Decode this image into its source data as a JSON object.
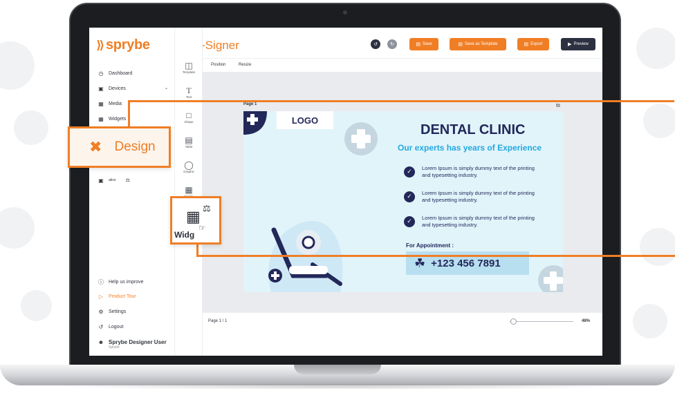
{
  "brand": {
    "logo_text": "sprybe",
    "app_title": "Di-Signer"
  },
  "sidebar": {
    "items": [
      {
        "label": "Dashboard",
        "icon": "dashboard-icon"
      },
      {
        "label": "Devices",
        "icon": "devices-icon"
      },
      {
        "label": "Media",
        "icon": "media-icon"
      },
      {
        "label": "Widgets",
        "icon": "widgets-icon"
      },
      {
        "label": "Help us improve",
        "icon": "help-icon"
      },
      {
        "label": "Product Tour",
        "icon": "tour-icon"
      },
      {
        "label": "Settings",
        "icon": "gear-icon"
      },
      {
        "label": "Logout",
        "icon": "logout-icon"
      }
    ],
    "partial_item": "ativo",
    "user_name": "Sprybe Designer User",
    "user_org": "Sprybe"
  },
  "rail": {
    "tools": [
      "Template",
      "Text",
      "Shape",
      "Table",
      "Graphic",
      "Media"
    ]
  },
  "toolbar": {
    "save": "Save",
    "save_template": "Save as Template",
    "export": "Export",
    "preview": "Preview"
  },
  "subbar": {
    "position": "Position",
    "resize": "Resize"
  },
  "canvas": {
    "page_label": "Page 1",
    "page_count": "Page 1 / 1",
    "zoom": "48%",
    "zoom_fraction": 0.05
  },
  "design": {
    "logo": "LOGO",
    "title": "DENTAL CLINIC",
    "subtitle": "Our experts has years of Experience",
    "points": [
      "Lorem Ipsum is simply dummy text of the printing and typesetting industry.",
      "Lorem Ipsum is simply dummy text of the printing and typesetting industry.",
      "Lorem Ipsum is simply dummy text of the printing and typesetting industry."
    ],
    "appointment": "For Appointment :",
    "phone": "+123 456 7891"
  },
  "callouts": {
    "design": "Design",
    "widget": "Widg"
  },
  "colors": {
    "accent": "#f07e25",
    "navy": "#23285a",
    "sky": "#23a8df",
    "page_bg": "#e1f4fa"
  }
}
